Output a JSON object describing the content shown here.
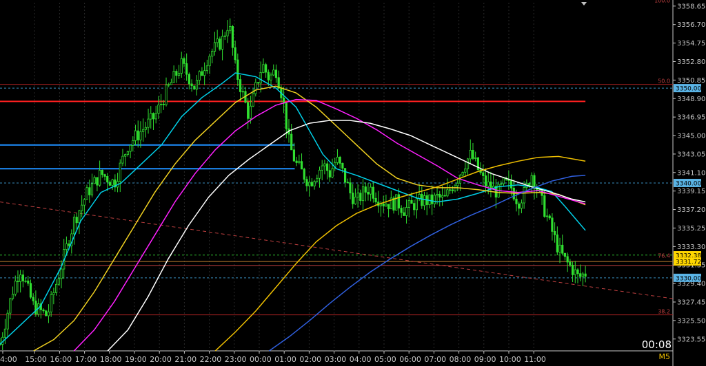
{
  "chart_data": {
    "type": "line",
    "timeframe": "M5",
    "bar_timer": "00:08",
    "y_ticks": [
      "3358.65",
      "3356.70",
      "3354.75",
      "3352.80",
      "3350.85",
      "3348.90",
      "3346.95",
      "3345.00",
      "3343.05",
      "3341.10",
      "3339.15",
      "3337.20",
      "3335.25",
      "3333.30",
      "3331.35",
      "3329.40",
      "3327.45",
      "3325.50",
      "3323.55"
    ],
    "x_ticks": [
      "4:00",
      "15:00",
      "16:00",
      "17:00",
      "18:00",
      "19:00",
      "20:00",
      "21:00",
      "22:00",
      "23:00",
      "00:00",
      "01:00",
      "02:00",
      "03:00",
      "04:00",
      "05:00",
      "06:00",
      "07:00",
      "08:00",
      "09:00",
      "10:00",
      "11:00"
    ],
    "ylim": [
      3322.3,
      3359.0
    ],
    "price_labels": [
      {
        "text": "3350.00",
        "value": 3350.0,
        "color": "#5ab4e6"
      },
      {
        "text": "3340.00",
        "value": 3340.0,
        "color": "#5ab4e6"
      },
      {
        "text": "3332.38",
        "value": 3332.38,
        "color": "#ffd700"
      },
      {
        "text": "3331.72",
        "value": 3331.72,
        "color": "#ffd700"
      },
      {
        "text": "3330.00",
        "value": 3330.0,
        "color": "#5ab4e6"
      }
    ],
    "fib_labels": [
      {
        "text": "100.0",
        "value": 3358.9
      },
      {
        "text": "50.0",
        "value": 3350.4
      },
      {
        "text": "76.4",
        "value": 3332.0
      },
      {
        "text": "38.2",
        "value": 3326.1
      }
    ],
    "levels": [
      {
        "value": 3350.4,
        "color": "#a02020",
        "style": "solid",
        "x0": 0,
        "x1": 1
      },
      {
        "value": 3350.0,
        "color": "#3a8ec0",
        "style": "dash",
        "x0": 0,
        "x1": 1
      },
      {
        "value": 3348.6,
        "color": "#ff2020",
        "style": "bold",
        "x0": 0,
        "x1": 0.87
      },
      {
        "value": 3344.0,
        "color": "#1e90ff",
        "style": "bold",
        "x0": 0,
        "x1": 0.438
      },
      {
        "value": 3341.5,
        "color": "#1e90ff",
        "style": "bold",
        "x0": 0,
        "x1": 0.438
      },
      {
        "value": 3340.0,
        "color": "#3a8ec0",
        "style": "dash",
        "x0": 0,
        "x1": 1
      },
      {
        "value": 3332.4,
        "color": "#30c030",
        "style": "dash",
        "x0": 0,
        "x1": 1
      },
      {
        "value": 3331.72,
        "color": "#c08030",
        "style": "solid",
        "x0": 0,
        "x1": 1
      },
      {
        "value": 3331.3,
        "color": "#c04040",
        "style": "solid",
        "x0": 0,
        "x1": 1
      },
      {
        "value": 3330.0,
        "color": "#3a8ec0",
        "style": "dash",
        "x0": 0,
        "x1": 1
      },
      {
        "value": 3326.1,
        "color": "#a02020",
        "style": "solid",
        "x0": 0,
        "x1": 1
      }
    ],
    "series": [
      {
        "color": "#00d0e8",
        "points": [
          [
            0,
            3323
          ],
          [
            0.03,
            3325
          ],
          [
            0.06,
            3327
          ],
          [
            0.09,
            3331
          ],
          [
            0.12,
            3336
          ],
          [
            0.15,
            3339
          ],
          [
            0.18,
            3340
          ],
          [
            0.21,
            3342
          ],
          [
            0.24,
            3344
          ],
          [
            0.27,
            3347
          ],
          [
            0.3,
            3349
          ],
          [
            0.33,
            3350.5
          ],
          [
            0.35,
            3351.6
          ],
          [
            0.38,
            3351.2
          ],
          [
            0.41,
            3350
          ],
          [
            0.44,
            3348
          ],
          [
            0.46,
            3345.5
          ],
          [
            0.48,
            3343
          ],
          [
            0.5,
            3341.5
          ],
          [
            0.53,
            3340.8
          ],
          [
            0.56,
            3340
          ],
          [
            0.59,
            3339.2
          ],
          [
            0.62,
            3338.4
          ],
          [
            0.65,
            3338
          ],
          [
            0.68,
            3338.3
          ],
          [
            0.71,
            3338.9
          ],
          [
            0.74,
            3339.6
          ],
          [
            0.77,
            3339.8
          ],
          [
            0.8,
            3339.5
          ],
          [
            0.82,
            3339.1
          ],
          [
            0.84,
            3337.5
          ],
          [
            0.87,
            3335
          ]
        ]
      },
      {
        "color": "#f0d020",
        "points": [
          [
            0.05,
            3322.3
          ],
          [
            0.08,
            3323.5
          ],
          [
            0.11,
            3325.5
          ],
          [
            0.14,
            3328.5
          ],
          [
            0.17,
            3332
          ],
          [
            0.2,
            3335.5
          ],
          [
            0.23,
            3339
          ],
          [
            0.26,
            3342
          ],
          [
            0.29,
            3344.5
          ],
          [
            0.32,
            3346.5
          ],
          [
            0.35,
            3348.5
          ],
          [
            0.38,
            3349.8
          ],
          [
            0.41,
            3350.2
          ],
          [
            0.44,
            3349.5
          ],
          [
            0.47,
            3348
          ],
          [
            0.5,
            3346
          ],
          [
            0.53,
            3344
          ],
          [
            0.56,
            3342
          ],
          [
            0.59,
            3340.5
          ],
          [
            0.62,
            3339.8
          ],
          [
            0.65,
            3339.5
          ],
          [
            0.68,
            3339.5
          ],
          [
            0.71,
            3339.3
          ],
          [
            0.74,
            3339
          ],
          [
            0.77,
            3338.9
          ],
          [
            0.8,
            3339
          ],
          [
            0.83,
            3338.8
          ],
          [
            0.87,
            3337.7
          ]
        ]
      },
      {
        "color": "#ff20ff",
        "points": [
          [
            0.11,
            3322.3
          ],
          [
            0.14,
            3324.5
          ],
          [
            0.17,
            3327.5
          ],
          [
            0.2,
            3331
          ],
          [
            0.23,
            3334.5
          ],
          [
            0.26,
            3338
          ],
          [
            0.29,
            3341
          ],
          [
            0.32,
            3343.5
          ],
          [
            0.35,
            3345.5
          ],
          [
            0.38,
            3347
          ],
          [
            0.41,
            3348.2
          ],
          [
            0.44,
            3348.8
          ],
          [
            0.47,
            3348.7
          ],
          [
            0.5,
            3347.8
          ],
          [
            0.53,
            3346.8
          ],
          [
            0.56,
            3345.6
          ],
          [
            0.59,
            3344.2
          ],
          [
            0.62,
            3343
          ],
          [
            0.65,
            3341.8
          ],
          [
            0.68,
            3340.5
          ],
          [
            0.71,
            3339.8
          ],
          [
            0.74,
            3339.2
          ],
          [
            0.77,
            3339
          ],
          [
            0.8,
            3339.2
          ],
          [
            0.83,
            3338.6
          ],
          [
            0.87,
            3337.8
          ]
        ]
      },
      {
        "color": "#ffffff",
        "points": [
          [
            0.16,
            3322.3
          ],
          [
            0.19,
            3324.5
          ],
          [
            0.22,
            3328
          ],
          [
            0.25,
            3332
          ],
          [
            0.28,
            3335.5
          ],
          [
            0.31,
            3338.5
          ],
          [
            0.34,
            3340.8
          ],
          [
            0.37,
            3342.5
          ],
          [
            0.4,
            3344
          ],
          [
            0.43,
            3345.5
          ],
          [
            0.46,
            3346.3
          ],
          [
            0.49,
            3346.6
          ],
          [
            0.52,
            3346.6
          ],
          [
            0.55,
            3346.3
          ],
          [
            0.58,
            3345.7
          ],
          [
            0.61,
            3345
          ],
          [
            0.64,
            3344
          ],
          [
            0.67,
            3343
          ],
          [
            0.7,
            3342
          ],
          [
            0.73,
            3341
          ],
          [
            0.76,
            3340.3
          ],
          [
            0.79,
            3339.6
          ],
          [
            0.82,
            3339
          ],
          [
            0.85,
            3338.3
          ],
          [
            0.87,
            3338
          ]
        ]
      },
      {
        "color": "#f0c000",
        "points": [
          [
            0.32,
            3322.3
          ],
          [
            0.35,
            3324.3
          ],
          [
            0.38,
            3326.5
          ],
          [
            0.41,
            3329
          ],
          [
            0.44,
            3331.5
          ],
          [
            0.47,
            3333.8
          ],
          [
            0.5,
            3335.5
          ],
          [
            0.53,
            3336.8
          ],
          [
            0.56,
            3337.7
          ],
          [
            0.59,
            3338.4
          ],
          [
            0.62,
            3339
          ],
          [
            0.65,
            3339.6
          ],
          [
            0.68,
            3340.4
          ],
          [
            0.71,
            3341.2
          ],
          [
            0.74,
            3341.8
          ],
          [
            0.77,
            3342.3
          ],
          [
            0.8,
            3342.7
          ],
          [
            0.83,
            3342.8
          ],
          [
            0.87,
            3342.3
          ]
        ]
      },
      {
        "color": "#3060e0",
        "points": [
          [
            0.4,
            3322.3
          ],
          [
            0.43,
            3323.8
          ],
          [
            0.46,
            3325.5
          ],
          [
            0.49,
            3327.3
          ],
          [
            0.52,
            3329
          ],
          [
            0.55,
            3330.6
          ],
          [
            0.58,
            3332
          ],
          [
            0.61,
            3333.3
          ],
          [
            0.64,
            3334.5
          ],
          [
            0.67,
            3335.6
          ],
          [
            0.7,
            3336.6
          ],
          [
            0.73,
            3337.5
          ],
          [
            0.76,
            3338.5
          ],
          [
            0.79,
            3339.4
          ],
          [
            0.82,
            3340.2
          ],
          [
            0.85,
            3340.7
          ],
          [
            0.87,
            3340.8
          ]
        ]
      }
    ],
    "trend_line": {
      "color": "#c04040",
      "points": [
        [
          0,
          3338
        ],
        [
          1,
          3327.8
        ]
      ]
    },
    "price_path": [
      [
        0,
        3323
      ],
      [
        0.02,
        3329
      ],
      [
        0.03,
        3331
      ],
      [
        0.05,
        3327
      ],
      [
        0.07,
        3326
      ],
      [
        0.09,
        3331
      ],
      [
        0.11,
        3336
      ],
      [
        0.13,
        3339
      ],
      [
        0.15,
        3341
      ],
      [
        0.17,
        3340
      ],
      [
        0.19,
        3344
      ],
      [
        0.21,
        3345.5
      ],
      [
        0.23,
        3347
      ],
      [
        0.25,
        3350
      ],
      [
        0.27,
        3352.5
      ],
      [
        0.29,
        3350
      ],
      [
        0.31,
        3353.5
      ],
      [
        0.33,
        3355
      ],
      [
        0.34,
        3357
      ],
      [
        0.35,
        3352
      ],
      [
        0.36,
        3349.5
      ],
      [
        0.37,
        3347
      ],
      [
        0.38,
        3350
      ],
      [
        0.39,
        3352.5
      ],
      [
        0.4,
        3351
      ],
      [
        0.41,
        3352
      ],
      [
        0.42,
        3349
      ],
      [
        0.43,
        3344
      ],
      [
        0.44,
        3342
      ],
      [
        0.45,
        3341
      ],
      [
        0.46,
        3340
      ],
      [
        0.47,
        3341
      ],
      [
        0.48,
        3342
      ],
      [
        0.49,
        3341
      ],
      [
        0.5,
        3342.5
      ],
      [
        0.51,
        3341
      ],
      [
        0.52,
        3339
      ],
      [
        0.53,
        3338
      ],
      [
        0.54,
        3339
      ],
      [
        0.55,
        3339.5
      ],
      [
        0.56,
        3338.5
      ],
      [
        0.57,
        3338
      ],
      [
        0.58,
        3337.8
      ],
      [
        0.59,
        3338
      ],
      [
        0.6,
        3337.2
      ],
      [
        0.61,
        3337.5
      ],
      [
        0.62,
        3338
      ],
      [
        0.63,
        3338.2
      ],
      [
        0.64,
        3338
      ],
      [
        0.65,
        3338.5
      ],
      [
        0.66,
        3338.2
      ],
      [
        0.67,
        3339.5
      ],
      [
        0.68,
        3340.5
      ],
      [
        0.69,
        3342
      ],
      [
        0.7,
        3343
      ],
      [
        0.71,
        3341.5
      ],
      [
        0.72,
        3340
      ],
      [
        0.73,
        3339.5
      ],
      [
        0.74,
        3339
      ],
      [
        0.75,
        3340
      ],
      [
        0.76,
        3339.5
      ],
      [
        0.77,
        3338
      ],
      [
        0.78,
        3339
      ],
      [
        0.79,
        3341
      ],
      [
        0.8,
        3339
      ],
      [
        0.81,
        3337
      ],
      [
        0.82,
        3335
      ],
      [
        0.83,
        3333
      ],
      [
        0.84,
        3331.8
      ],
      [
        0.85,
        3331
      ],
      [
        0.86,
        3330
      ],
      [
        0.87,
        3330.5
      ]
    ]
  }
}
